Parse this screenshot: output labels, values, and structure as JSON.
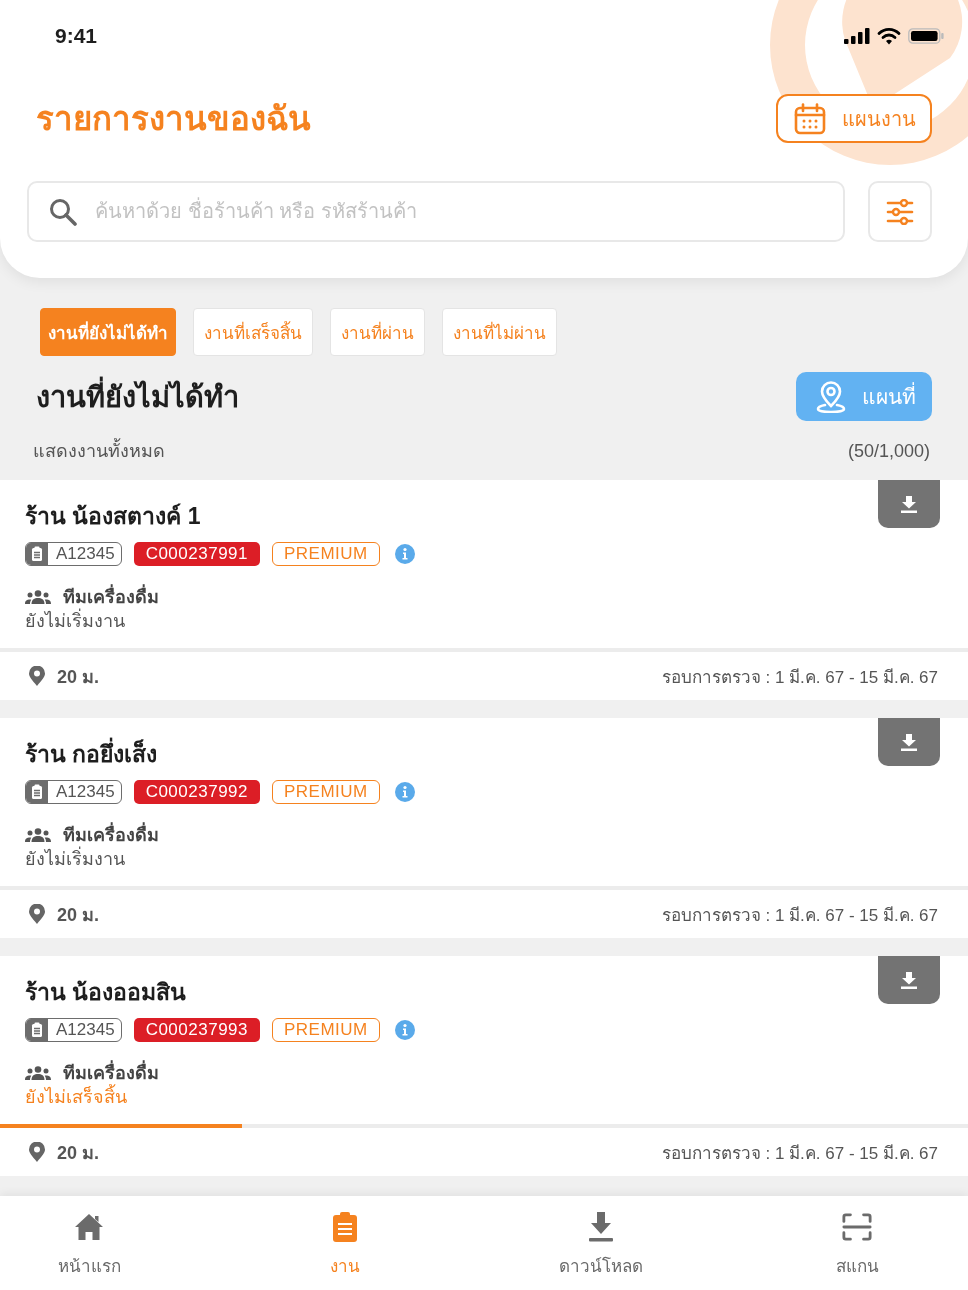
{
  "status_bar": {
    "time": "9:41"
  },
  "header": {
    "title": "รายการงานของฉัน",
    "plan_button": "แผนงาน"
  },
  "search": {
    "placeholder": "ค้นหาด้วย ชื่อร้านค้า หรือ รหัสร้านค้า"
  },
  "tabs": [
    {
      "label": "งานที่ยังไม่ได้ทำ",
      "selected": true
    },
    {
      "label": "งานที่เสร็จสิ้น",
      "selected": false
    },
    {
      "label": "งานที่ผ่าน",
      "selected": false
    },
    {
      "label": "งานที่ไม่ผ่าน",
      "selected": false
    }
  ],
  "section": {
    "title": "งานที่ยังไม่ได้ทำ",
    "map_button": "แผนที่",
    "subtitle": "แสดงงานทั้งหมด",
    "count": "(50/1,000)"
  },
  "jobs": [
    {
      "name": "ร้าน น้องสตางค์ 1",
      "doc_id": "A12345",
      "code": "C000237991",
      "tier": "PREMIUM",
      "team": "ทีมเครื่องดื่ม",
      "status": "ยังไม่เริ่มงาน",
      "in_progress": false,
      "level": 0,
      "distance": "20 ม.",
      "round": "รอบการตรวจ : 1 มี.ค. 67 - 15 มี.ค. 67"
    },
    {
      "name": "ร้าน กอยึ่งเส็ง",
      "doc_id": "A12345",
      "code": "C000237992",
      "tier": "PREMIUM",
      "team": "ทีมเครื่องดื่ม",
      "status": "ยังไม่เริ่มงาน",
      "in_progress": false,
      "level": 0,
      "distance": "20 ม.",
      "round": "รอบการตรวจ : 1 มี.ค. 67 - 15 มี.ค. 67"
    },
    {
      "name": "ร้าน น้องออมสิน",
      "doc_id": "A12345",
      "code": "C000237993",
      "tier": "PREMIUM",
      "team": "ทีมเครื่องดื่ม",
      "status": "ยังไม่เสร็จสิ้น",
      "in_progress": true,
      "level": 0.25,
      "distance": "20 ม.",
      "round": "รอบการตรวจ : 1 มี.ค. 67 - 15 มี.ค. 67"
    }
  ],
  "nav": [
    {
      "label": "หน้าแรก",
      "kind": "home",
      "selected": false
    },
    {
      "label": "งาน",
      "kind": "tasks",
      "selected": true
    },
    {
      "label": "ดาวน์โหลด",
      "kind": "download",
      "selected": false
    },
    {
      "label": "สแกน",
      "kind": "scan",
      "selected": false
    }
  ]
}
